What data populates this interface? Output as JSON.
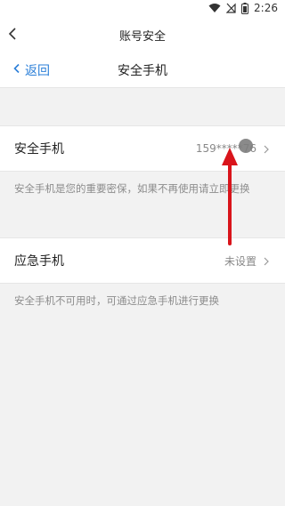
{
  "status_bar": {
    "time": "2:26",
    "icons": [
      "wifi-icon",
      "signal-off-icon",
      "battery-icon"
    ]
  },
  "header": {
    "title": "账号安全",
    "back_icon": "chevron-left-icon"
  },
  "subheader": {
    "back_label": "返回",
    "title": "安全手机"
  },
  "security_phone": {
    "label": "安全手机",
    "value": "159*****76",
    "note": "安全手机是您的重要密保，如果不再使用请立即更换"
  },
  "emergency_phone": {
    "label": "应急手机",
    "value": "未设置",
    "note": "安全手机不可用时，可通过应急手机进行更换"
  },
  "colors": {
    "accent": "#2b7fd8",
    "annotation_arrow": "#d9141b"
  }
}
